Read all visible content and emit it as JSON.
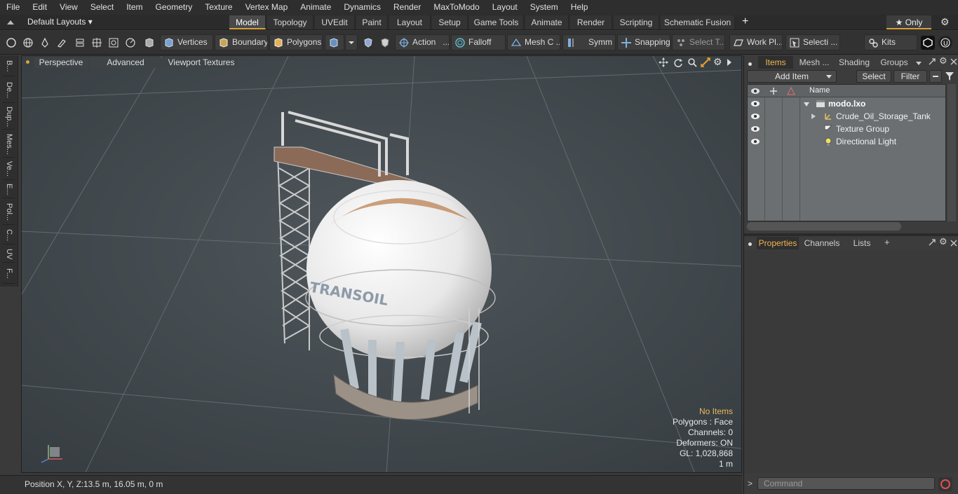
{
  "menu": [
    "File",
    "Edit",
    "View",
    "Select",
    "Item",
    "Geometry",
    "Texture",
    "Vertex Map",
    "Animate",
    "Dynamics",
    "Render",
    "MaxToModo",
    "Layout",
    "System",
    "Help"
  ],
  "layouts": {
    "label": "Default Layouts ▾",
    "tabs": [
      "Model",
      "Topology",
      "UVEdit",
      "Paint",
      "Layout",
      "Setup",
      "Game Tools",
      "Animate",
      "Render",
      "Scripting",
      "Schematic Fusion"
    ],
    "active": "Model",
    "add": "+",
    "only": "★  Only",
    "gear": "⚙"
  },
  "toolbar": {
    "vertices": "Vertices",
    "boundary": "Boundary",
    "polygons": "Polygons",
    "action": "Action",
    "action_more": "...",
    "falloff": "Falloff",
    "mesh": "Mesh C ...",
    "symm": "Symm ...",
    "snapping": "Snapping",
    "select_t": "Select T...",
    "workplane": "Work Pl...",
    "selecti": "Selecti ...",
    "kits": "Kits"
  },
  "left_strip": [
    "B...",
    "De...",
    "Dup...",
    "Mes...",
    "Ve...",
    "E...",
    "Pol...",
    "C...",
    "UV",
    "F..."
  ],
  "viewport": {
    "perspective": "Perspective",
    "advanced": "Advanced",
    "viewport_textures": "Viewport Textures",
    "logo_text": "TRANSOIL",
    "stats": {
      "no_items": "No Items",
      "polygons": "Polygons : Face",
      "channels": "Channels: 0",
      "deformers": "Deformers: ON",
      "gl": "GL: 1,028,868",
      "scale": "1 m"
    }
  },
  "statusbar": {
    "position_label": "Position X, Y, Z:",
    "position_value": "13.5 m, 16.05 m, 0 m"
  },
  "items_panel": {
    "tabs": [
      "Items",
      "Mesh ...",
      "Shading",
      "Groups"
    ],
    "add_item": "Add Item",
    "select": "Select",
    "filter": "Filter",
    "col_name": "Name",
    "tree": [
      {
        "label": "modo.lxo",
        "bold": true
      },
      {
        "label": "Crude_Oil_Storage_Tank"
      },
      {
        "label": "Texture Group"
      },
      {
        "label": "Directional Light"
      }
    ]
  },
  "props_panel": {
    "tabs": [
      "Properties",
      "Channels",
      "Lists"
    ],
    "add": "+"
  },
  "command": {
    "placeholder": "Command"
  },
  "colors": {
    "accent": "#f0b650",
    "bg": "#3a3a3a",
    "viewport": "#4b5257"
  }
}
